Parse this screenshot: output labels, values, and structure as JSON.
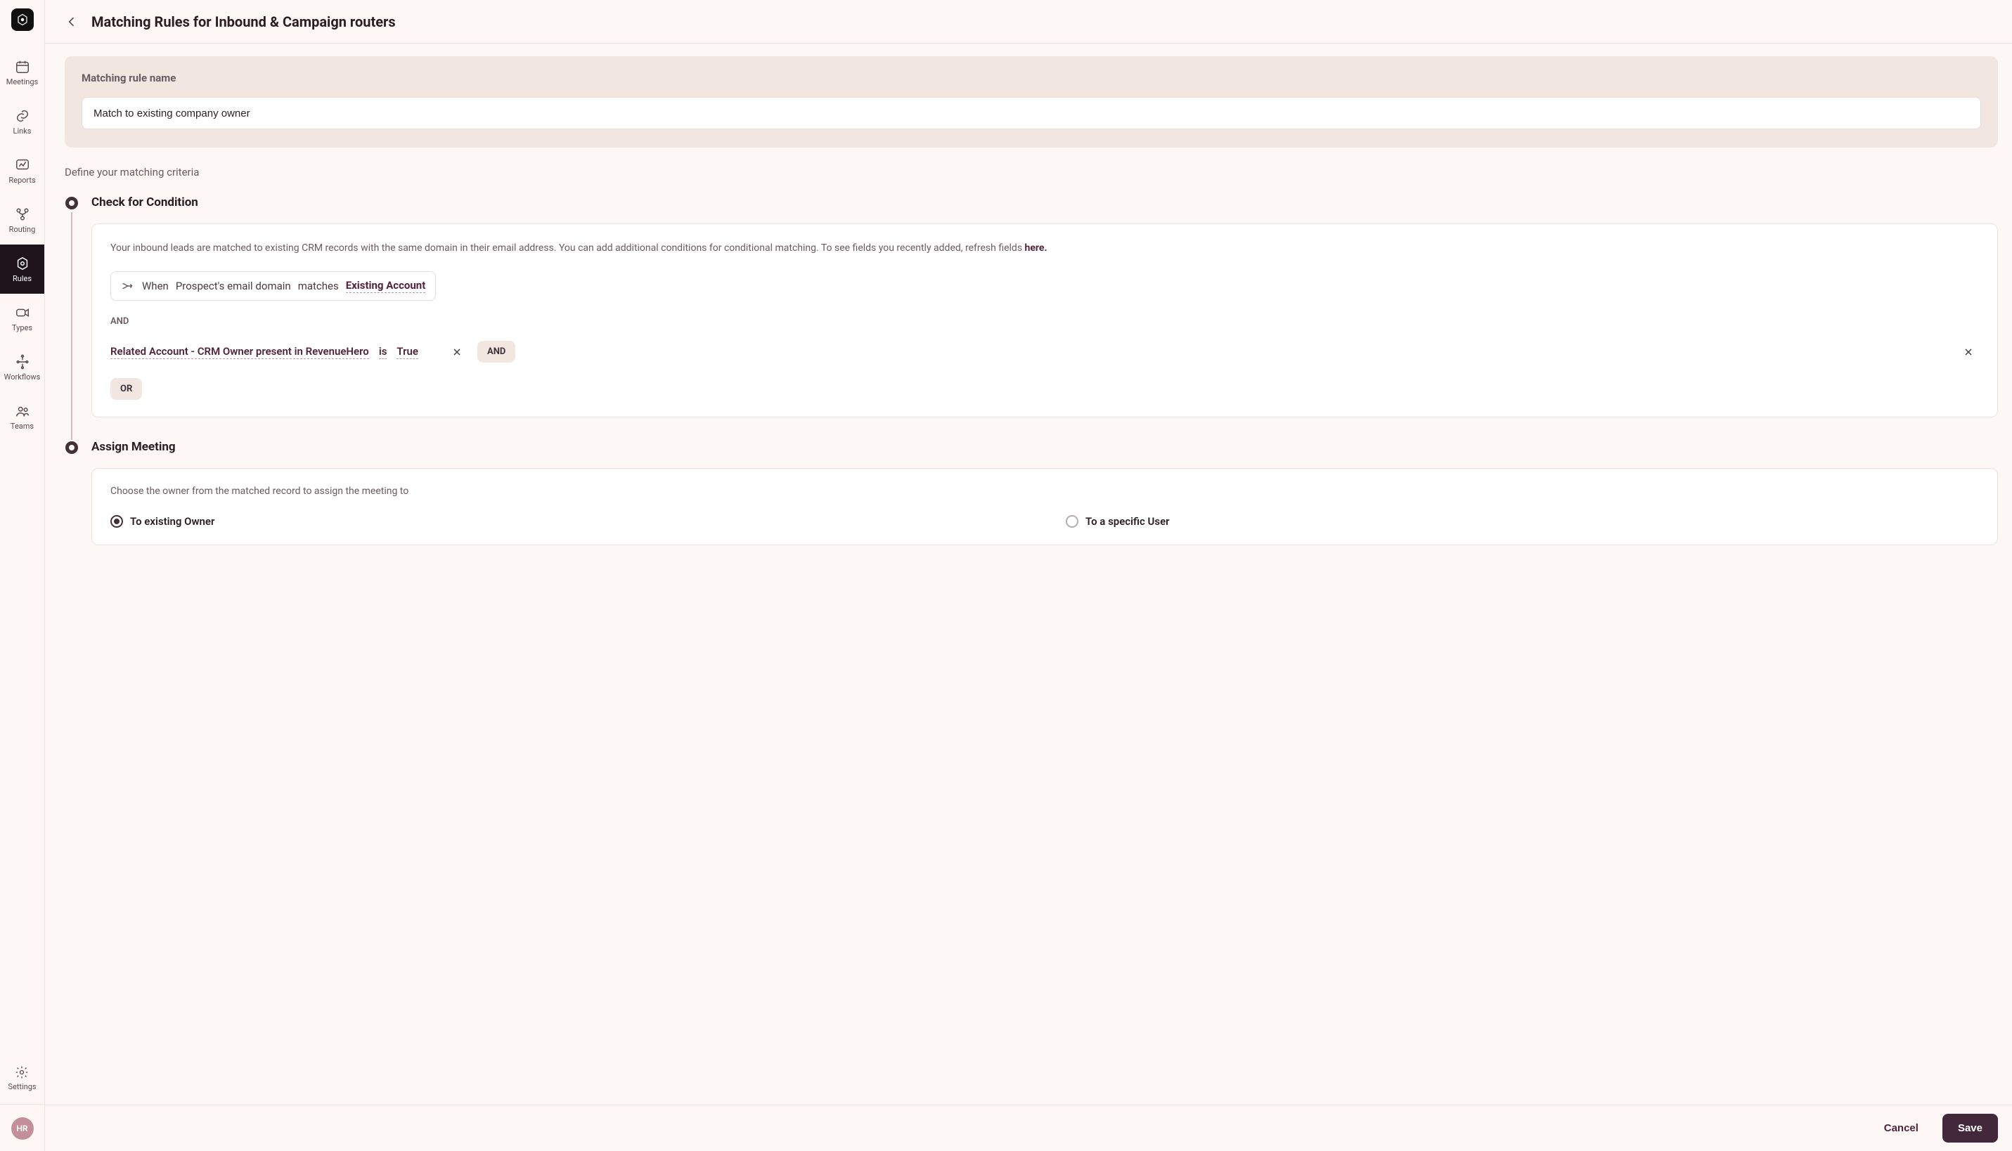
{
  "logo_glyph": "⎈",
  "sidebar": {
    "items": [
      {
        "label": "Meetings",
        "icon": "calendar"
      },
      {
        "label": "Links",
        "icon": "link"
      },
      {
        "label": "Reports",
        "icon": "chart"
      },
      {
        "label": "Routing",
        "icon": "route"
      },
      {
        "label": "Rules",
        "icon": "hex",
        "active": true
      },
      {
        "label": "Types",
        "icon": "video"
      },
      {
        "label": "Workflows",
        "icon": "flow"
      },
      {
        "label": "Teams",
        "icon": "users"
      }
    ],
    "settings_label": "Settings",
    "avatar_initials": "HR"
  },
  "header": {
    "title": "Matching Rules for Inbound & Campaign routers"
  },
  "name_card": {
    "label": "Matching rule name",
    "value": "Match to existing company owner"
  },
  "criteria_heading": "Define your matching criteria",
  "steps": {
    "check": {
      "title": "Check for Condition",
      "description": "Your inbound leads are matched to existing CRM records with the same domain in their email address. You can add additional conditions for conditional matching. To see fields you recently added, refresh fields ",
      "description_link": "here.",
      "base_condition": {
        "when": "When",
        "subject": "Prospect's email domain",
        "op": "matches",
        "target": "Existing Account"
      },
      "and_label": "AND",
      "condition_row": {
        "field": "Related Account - CRM Owner present in RevenueHero",
        "op": "is",
        "value": "True",
        "and_btn": "AND"
      },
      "or_btn": "OR"
    },
    "assign": {
      "title": "Assign Meeting",
      "description": "Choose the owner from the matched record to assign the meeting to",
      "options": {
        "existing": "To existing Owner",
        "specific": "To a specific User"
      }
    }
  },
  "footer": {
    "cancel": "Cancel",
    "save": "Save"
  }
}
